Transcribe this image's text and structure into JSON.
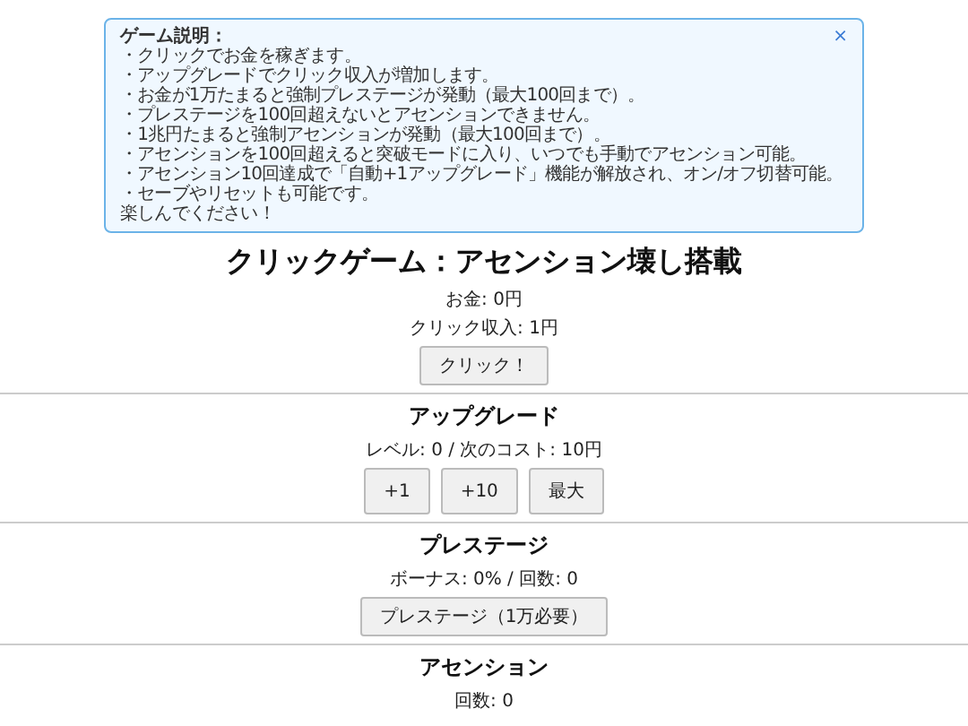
{
  "info": {
    "title": "ゲーム説明：",
    "close": "×",
    "lines": [
      "・クリックでお金を稼ぎます。",
      "・アップグレードでクリック収入が増加します。",
      "・お金が1万たまると強制プレステージが発動（最大100回まで）。",
      "・プレステージを100回超えないとアセンションできません。",
      "・1兆円たまると強制アセンションが発動（最大100回まで）。",
      "・アセンションを100回超えると突破モードに入り、いつでも手動でアセンション可能。",
      "・アセンション10回達成で「自動+1アップグレード」機能が解放され、オン/オフ切替可能。",
      "・セーブやリセットも可能です。",
      "楽しんでください！"
    ]
  },
  "title": "クリックゲーム：アセンション壊し搭載",
  "stats": [
    "お金: 0円",
    "クリック収入: 1円"
  ],
  "click_button": "クリック！",
  "sections": [
    {
      "heading": "アップグレード",
      "stat": "レベル: 0 / 次のコスト: 10円",
      "buttons": [
        "+1",
        "+10",
        "最大"
      ]
    },
    {
      "heading": "プレステージ",
      "stat": "ボーナス: 0% / 回数: 0",
      "buttons": [
        "プレステージ（1万必要）"
      ]
    },
    {
      "heading": "アセンション",
      "stat": "回数: 0"
    }
  ]
}
